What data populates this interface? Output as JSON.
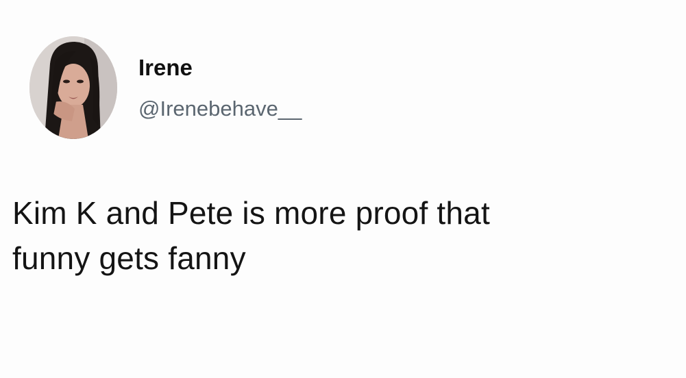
{
  "tweet": {
    "author": {
      "display_name": "Irene",
      "handle": "@Irenebehave__",
      "avatar_icon": "profile-photo-icon"
    },
    "text_lines": [
      "Kim K and Pete is more proof that",
      "funny gets fanny"
    ]
  },
  "colors": {
    "background": "#fdfdfd",
    "name_text": "#111111",
    "handle_text": "#5b6670",
    "body_text": "#141414"
  }
}
